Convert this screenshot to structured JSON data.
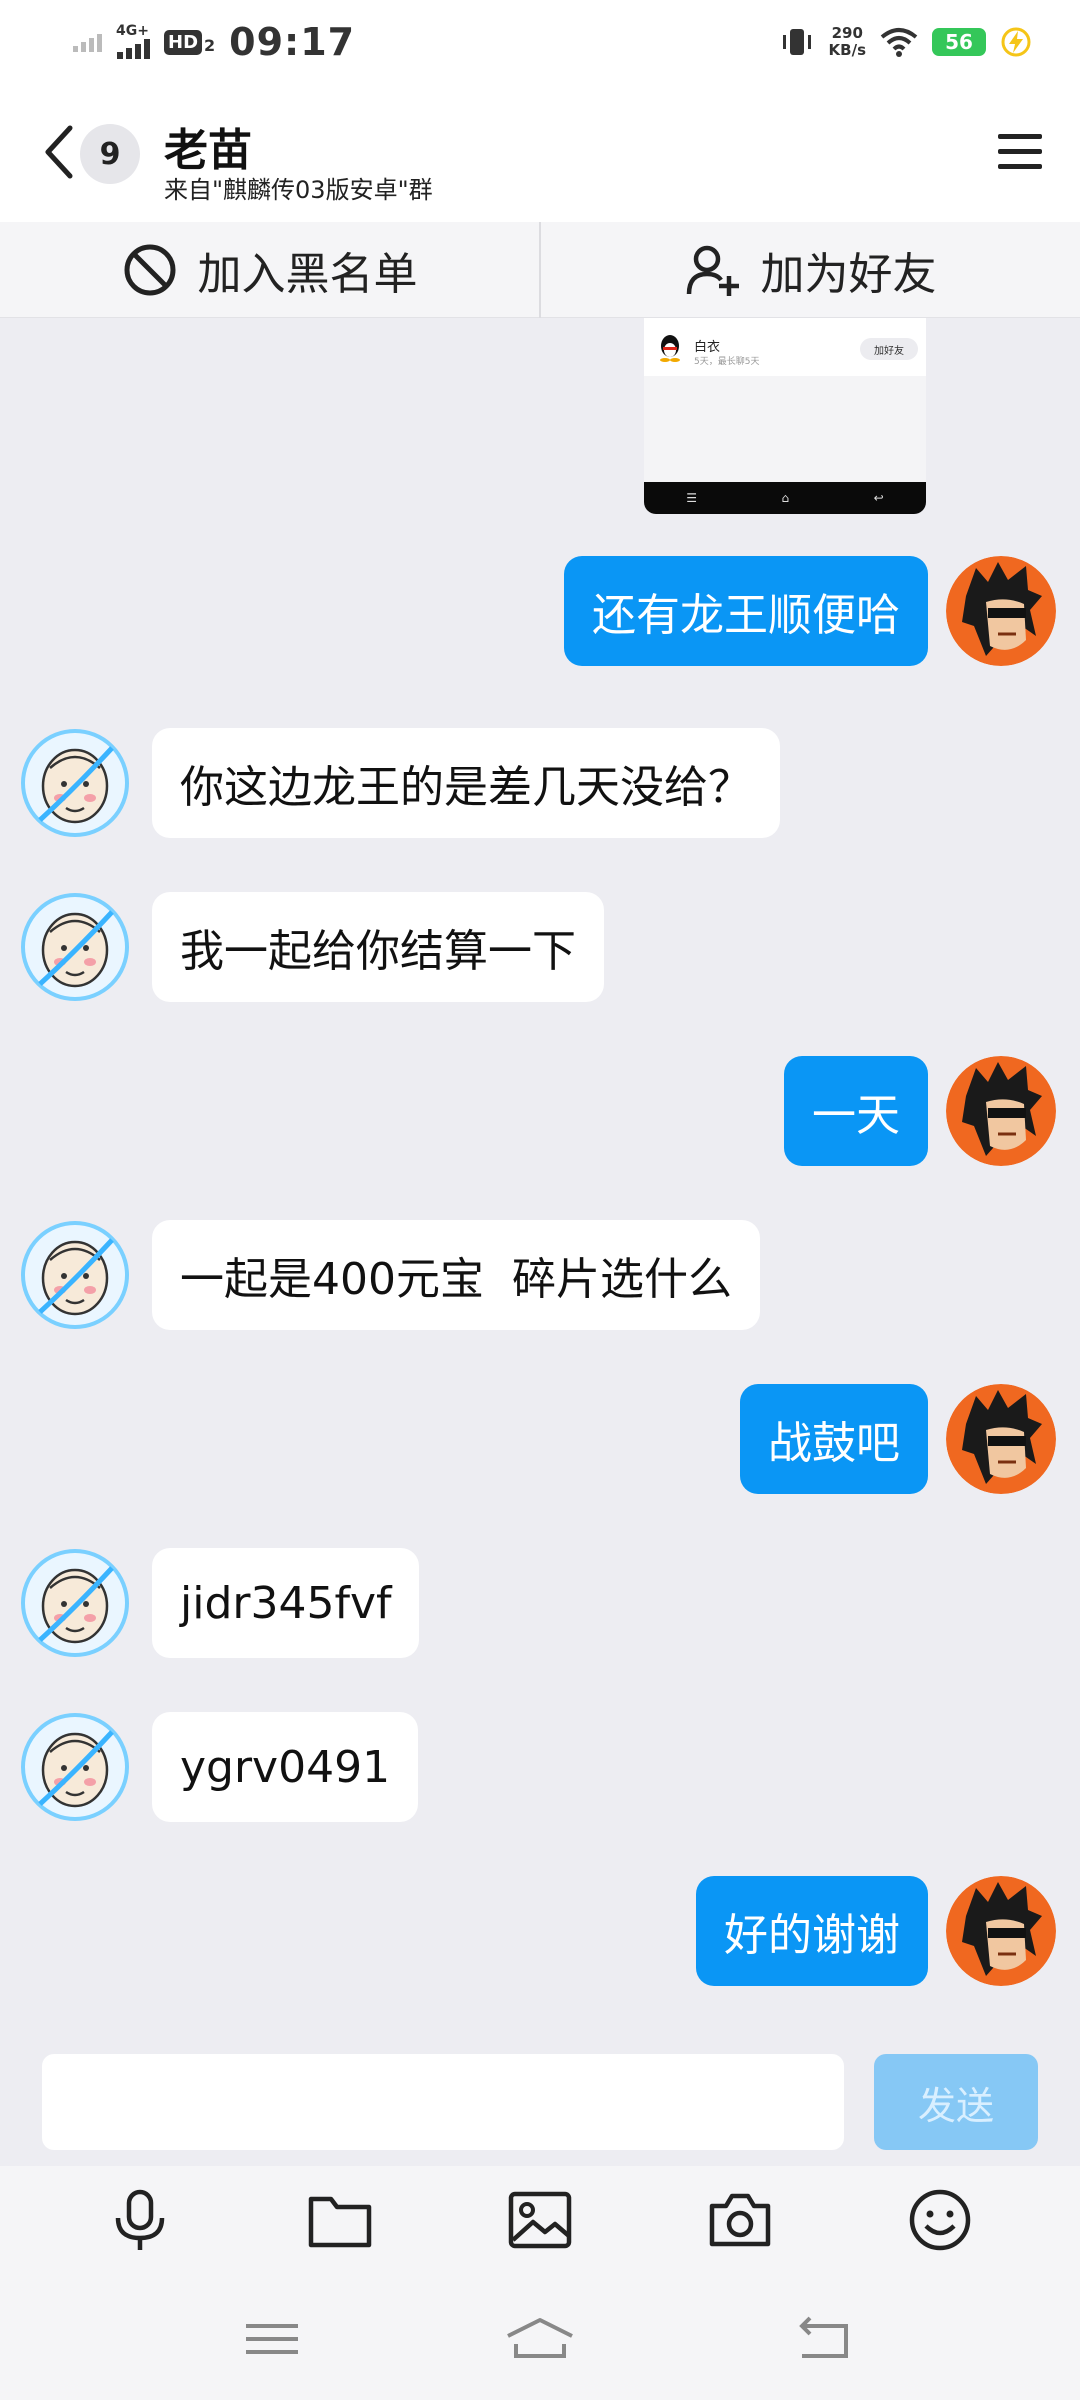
{
  "status_bar": {
    "network": "4G+",
    "hd_label": "HD",
    "hd_sub": "2",
    "time": "09:17",
    "speed_value": "290",
    "speed_unit": "KB/s",
    "battery": "56"
  },
  "header": {
    "unread_count": "9",
    "title": "老苗",
    "subtitle": "来自\"麒麟传03版安卓\"群"
  },
  "actions": {
    "blacklist_label": "加入黑名单",
    "add_friend_label": "加为好友"
  },
  "screenshot_preview": {
    "name": "白衣",
    "desc": "5天，最长聊5天",
    "add_button": "加好友"
  },
  "messages": [
    {
      "side": "out",
      "text": "还有龙王顺便哈"
    },
    {
      "side": "in",
      "text": "你这边龙王的是差几天没给？"
    },
    {
      "side": "in",
      "text": "我一起给你结算一下"
    },
    {
      "side": "out",
      "text": "一天"
    },
    {
      "side": "in",
      "text": "一起是400元宝  碎片选什么"
    },
    {
      "side": "out",
      "text": "战鼓吧"
    },
    {
      "side": "in",
      "text": "jidr345fvf"
    },
    {
      "side": "in",
      "text": "ygrv0491"
    },
    {
      "side": "out",
      "text": "好的谢谢"
    }
  ],
  "input": {
    "value": "",
    "placeholder": "",
    "send_label": "发送"
  },
  "toolbar": {
    "icons": [
      "microphone-icon",
      "folder-icon",
      "image-icon",
      "camera-icon",
      "emoji-icon"
    ]
  },
  "colors": {
    "outgoing_bubble": "#0a96f5",
    "incoming_bubble": "#ffffff",
    "send_button": "#86c8f5",
    "battery": "#34c759"
  }
}
